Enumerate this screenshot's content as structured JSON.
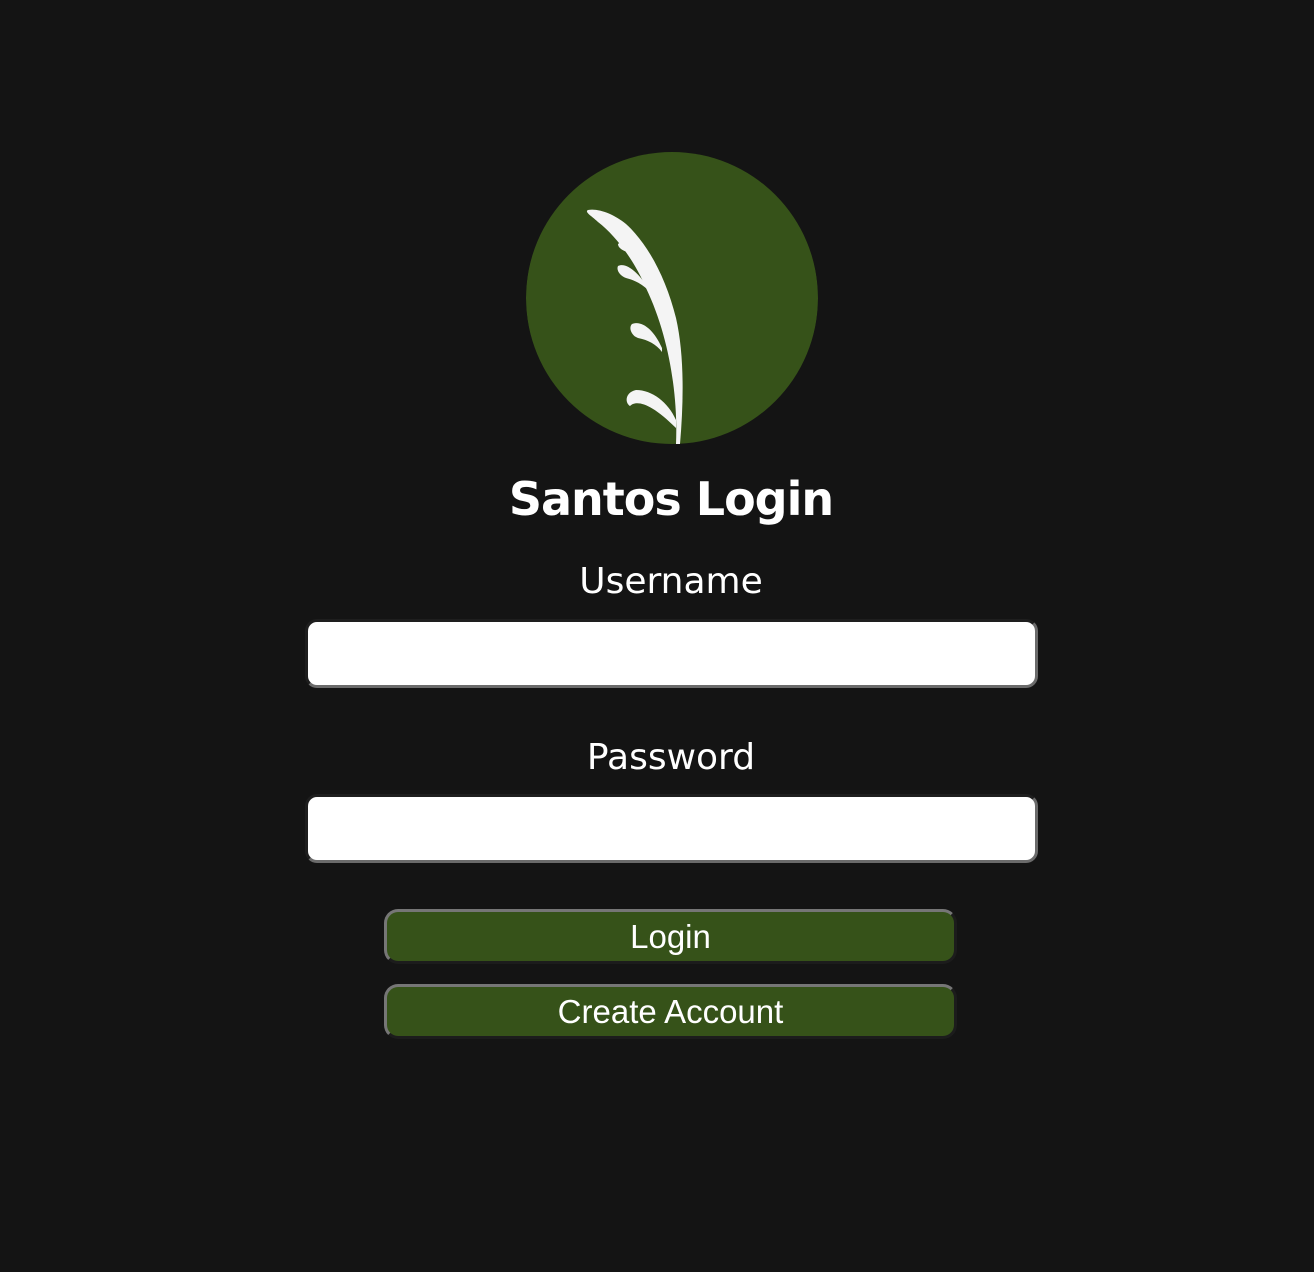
{
  "app": {
    "title": "Santos Login",
    "logo_icon": "grass-blade-icon",
    "colors": {
      "background": "#141414",
      "brand_green": "#365219",
      "text": "#ffffff",
      "input_background": "#ffffff"
    }
  },
  "form": {
    "username_label": "Username",
    "username_value": "",
    "password_label": "Password",
    "password_value": ""
  },
  "buttons": {
    "login_label": "Login",
    "create_account_label": "Create Account"
  }
}
